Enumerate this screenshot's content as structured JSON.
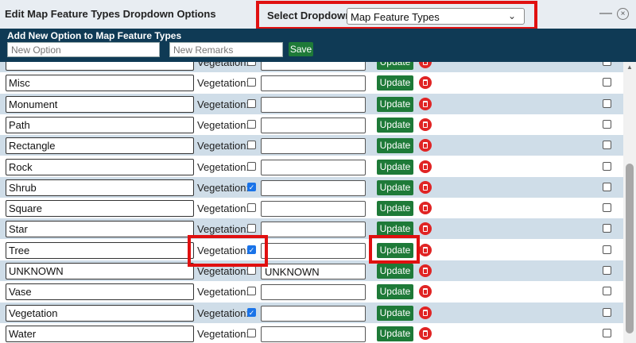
{
  "window": {
    "title": "Edit Map Feature Types Dropdown Options",
    "select_label": "Select Dropdown:",
    "select_value": "Map Feature Types",
    "minimize": "—",
    "close": "×"
  },
  "add_panel": {
    "title": "Add New Option to Map Feature Types",
    "option_placeholder": "New Option",
    "remarks_placeholder": "New Remarks",
    "save_label": "Save"
  },
  "colors": {
    "header_bg": "#0f3a55",
    "update_green": "#1e7a38",
    "delete_red": "#e02424",
    "highlight_red": "#e01010",
    "row_alt": "#cfdde8"
  },
  "veg_label": "Vegetation:",
  "update_label": "Update",
  "rows": [
    {
      "name": "",
      "vegetation": false,
      "remarks": ""
    },
    {
      "name": "Misc",
      "vegetation": false,
      "remarks": ""
    },
    {
      "name": "Monument",
      "vegetation": false,
      "remarks": ""
    },
    {
      "name": "Path",
      "vegetation": false,
      "remarks": ""
    },
    {
      "name": "Rectangle",
      "vegetation": false,
      "remarks": ""
    },
    {
      "name": "Rock",
      "vegetation": false,
      "remarks": ""
    },
    {
      "name": "Shrub",
      "vegetation": true,
      "remarks": ""
    },
    {
      "name": "Square",
      "vegetation": false,
      "remarks": ""
    },
    {
      "name": "Star",
      "vegetation": false,
      "remarks": ""
    },
    {
      "name": "Tree",
      "vegetation": true,
      "remarks": ""
    },
    {
      "name": "UNKNOWN",
      "vegetation": false,
      "remarks": "UNKNOWN"
    },
    {
      "name": "Vase",
      "vegetation": false,
      "remarks": ""
    },
    {
      "name": "Vegetation",
      "vegetation": true,
      "remarks": ""
    },
    {
      "name": "Water",
      "vegetation": false,
      "remarks": ""
    }
  ]
}
